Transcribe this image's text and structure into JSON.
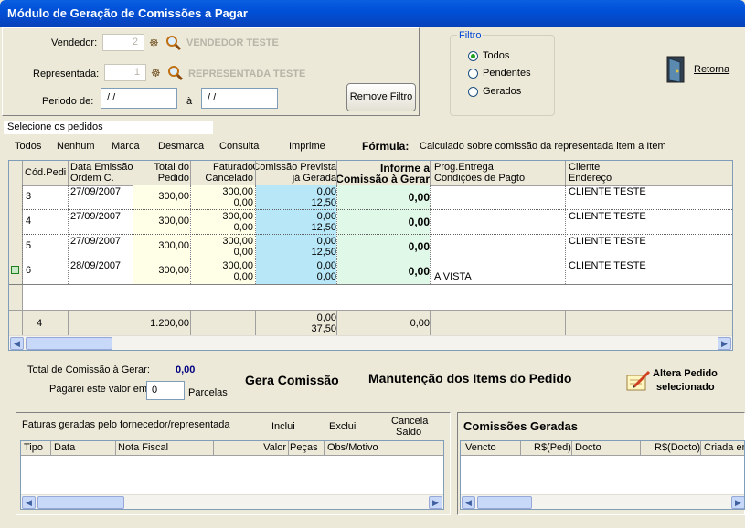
{
  "window": {
    "title": "Módulo de Geração de Comissões a Pagar"
  },
  "filter": {
    "vendedor_label": "Vendedor:",
    "vendedor_value": "2",
    "vendedor_name": "VENDEDOR TESTE",
    "representada_label": "Representada:",
    "representada_value": "1",
    "representada_name": "REPRESENTADA TESTE",
    "periodo_label": "Periodo de:",
    "periodo_from": " / /",
    "periodo_sep": "à",
    "periodo_to": " / /",
    "remove_label": "Remove Filtro"
  },
  "filtro": {
    "title": "Filtro",
    "options": [
      "Todos",
      "Pendentes",
      "Gerados"
    ],
    "selected": "Todos"
  },
  "retorna": {
    "label": "Retorna"
  },
  "selecione_label": "Selecione os pedidos",
  "toolbar": {
    "todos": "Todos",
    "nenhum": "Nenhum",
    "marca": "Marca",
    "desmarca": "Desmarca",
    "consulta": "Consulta",
    "imprime": "Imprime",
    "formula_label": "Fórmula:",
    "formula_text": "Calculado sobre comissão da representada item a Item"
  },
  "grid": {
    "headers": {
      "cod": "Cód.Pedi",
      "data1": "Data Emissão",
      "data2": "Ordem C.",
      "total1": "Total do",
      "total2": "Pedido",
      "fat1": "Faturado",
      "fat2": "Cancelado",
      "com1": "Comissão Prevista",
      "com2": "já Gerada",
      "inf1": "Informe a",
      "inf2": "Comissão à Gerar",
      "prog1": "Prog.Entrega",
      "prog2": "Condições de Pagto",
      "cli1": "Cliente",
      "cli2": "Endereço"
    },
    "rows": [
      {
        "cod": "3",
        "data": "27/09/2007",
        "total": "300,00",
        "fat": "300,00",
        "canc": "0,00",
        "prev": "0,00",
        "ger": "12,50",
        "inf": "0,00",
        "cond": "",
        "cliente": "CLIENTE TESTE"
      },
      {
        "cod": "4",
        "data": "27/09/2007",
        "total": "300,00",
        "fat": "300,00",
        "canc": "0,00",
        "prev": "0,00",
        "ger": "12,50",
        "inf": "0,00",
        "cond": "",
        "cliente": "CLIENTE TESTE"
      },
      {
        "cod": "5",
        "data": "27/09/2007",
        "total": "300,00",
        "fat": "300,00",
        "canc": "0,00",
        "prev": "0,00",
        "ger": "12,50",
        "inf": "0,00",
        "cond": "",
        "cliente": "CLIENTE TESTE"
      },
      {
        "cod": "6",
        "data": "28/09/2007",
        "total": "300,00",
        "fat": "300,00",
        "canc": "0,00",
        "prev": "0,00",
        "ger": "0,00",
        "inf": "0,00",
        "cond": "A VISTA",
        "cliente": "CLIENTE TESTE"
      }
    ],
    "totals": {
      "count": "4",
      "total": "1.200,00",
      "prev": "0,00",
      "ger": "37,50",
      "inf": "0,00"
    }
  },
  "summary": {
    "total_label": "Total de Comissão à Gerar:",
    "total_value": "0,00",
    "pagarei_label": "Pagarei este valor em",
    "parcelas_value": "0",
    "parcelas_label": "Parcelas",
    "gera_label": "Gera Comissão",
    "manutencao_label": "Manutenção dos Items do Pedido",
    "altera_line1": "Altera Pedido",
    "altera_line2": "selecionado"
  },
  "faturas": {
    "title": "Faturas geradas pelo fornecedor/representada",
    "inclui": "Inclui",
    "exclui": "Exclui",
    "cancela1": "Cancela",
    "cancela2": "Saldo",
    "columns": [
      "Tipo",
      "Data",
      "Nota Fiscal",
      "Valor",
      "Peças",
      "Obs/Motivo"
    ]
  },
  "comissoes": {
    "title": "Comissões Geradas",
    "columns": [
      "Vencto",
      "R$(Ped)",
      "Docto",
      "R$(Docto)",
      "Criada em"
    ]
  }
}
